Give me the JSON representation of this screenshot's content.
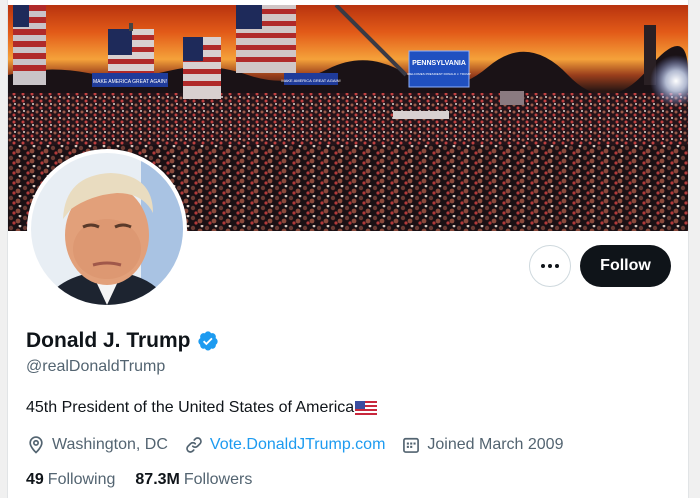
{
  "profile": {
    "name": "Donald J. Trump",
    "handle": "@realDonaldTrump",
    "bio": "45th President of the United States of America",
    "location": "Washington, DC",
    "website": "Vote.DonaldJTrump.com",
    "joined": "Joined March 2009",
    "following_count": "49",
    "following_label": "Following",
    "followers_count": "87.3M",
    "followers_label": "Followers"
  },
  "actions": {
    "follow_label": "Follow",
    "more_icon": "more-horizontal-icon"
  },
  "banner": {
    "sign_main": "PENNSYLVANIA",
    "sign_sub": "WELCOMES PRESIDENT DONALD J. TRUMP",
    "podium_text_1": "MAKE AMERICA GREAT AGAIN!",
    "podium_text_2": "MAKE AMERICA GREAT AGAIN!"
  },
  "icons": {
    "verified": "verified-badge-icon",
    "location": "location-pin-icon",
    "link": "link-icon",
    "calendar": "calendar-icon",
    "flag": "us-flag-emoji"
  },
  "colors": {
    "accent": "#1d9bf0",
    "text_primary": "#0f1419",
    "text_secondary": "#536471",
    "follow_bg": "#0f1419"
  }
}
